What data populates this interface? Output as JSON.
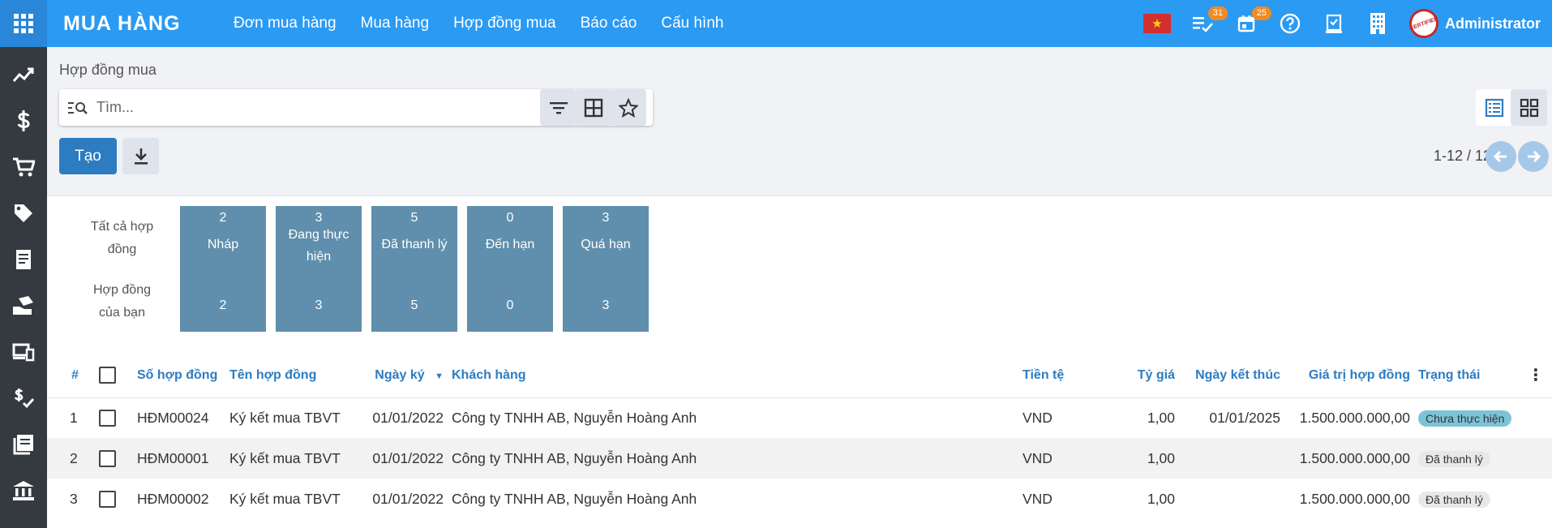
{
  "app": {
    "brand": "MUA HÀNG",
    "menu": [
      "Đơn mua hàng",
      "Mua hàng",
      "Hợp đồng mua",
      "Báo cáo",
      "Cấu hình"
    ],
    "badges": {
      "tasks": "31",
      "calendar": "25"
    },
    "flag_star": "★",
    "user": "Administrator",
    "avatar_text": "CERTIFIED"
  },
  "sidebar": [
    "chart-icon",
    "dollar-icon",
    "cart-icon",
    "tag-icon",
    "invoice-icon",
    "hand-icon",
    "devices-icon",
    "money-check-icon",
    "book-icon",
    "bank-icon"
  ],
  "page": {
    "breadcrumb": "Hợp đồng mua",
    "search_placeholder": "Tìm...",
    "create_label": "Tạo",
    "pager": "1-12 / 12"
  },
  "summary": {
    "row_all": "Tất cả hợp đồng",
    "row_mine": "Hợp đồng của bạn",
    "tiles": [
      {
        "count": "2",
        "label": "Nháp",
        "mine": "2"
      },
      {
        "count": "3",
        "label": "Đang thực hiện",
        "mine": "3"
      },
      {
        "count": "5",
        "label": "Đã thanh lý",
        "mine": "5"
      },
      {
        "count": "0",
        "label": "Đến hạn",
        "mine": "0"
      },
      {
        "count": "3",
        "label": "Quá hạn",
        "mine": "3"
      }
    ]
  },
  "table": {
    "columns": [
      "#",
      "Số hợp đồng",
      "Tên hợp đồng",
      "Ngày ký",
      "Khách hàng",
      "Tiền tệ",
      "Tỷ giá",
      "Ngày kết thúc",
      "Giá trị hợp đồng",
      "Trạng thái"
    ],
    "rows": [
      {
        "n": "1",
        "code": "HĐM00024",
        "name": "Ký kết mua TBVT",
        "date": "01/01/2022",
        "customer": "Công ty TNHH AB, Nguyễn Hoàng Anh",
        "currency": "VND",
        "rate": "1,00",
        "end": "01/01/2025",
        "value": "1.500.000.000,00",
        "status": "Chưa thực hiện"
      },
      {
        "n": "2",
        "code": "HĐM00001",
        "name": "Ký kết mua TBVT",
        "date": "01/01/2022",
        "customer": "Công ty TNHH AB, Nguyễn Hoàng Anh",
        "currency": "VND",
        "rate": "1,00",
        "end": "",
        "value": "1.500.000.000,00",
        "status": "Đã thanh lý"
      },
      {
        "n": "3",
        "code": "HĐM00002",
        "name": "Ký kết mua TBVT",
        "date": "01/01/2022",
        "customer": "Công ty TNHH AB, Nguyễn Hoàng Anh",
        "currency": "VND",
        "rate": "1,00",
        "end": "",
        "value": "1.500.000.000,00",
        "status": "Đã thanh lý"
      }
    ]
  },
  "colors": {
    "topbar": "#2b9af3",
    "sidebar": "#343a40",
    "tile": "#5f8fac",
    "accent": "#2d7cc2"
  }
}
